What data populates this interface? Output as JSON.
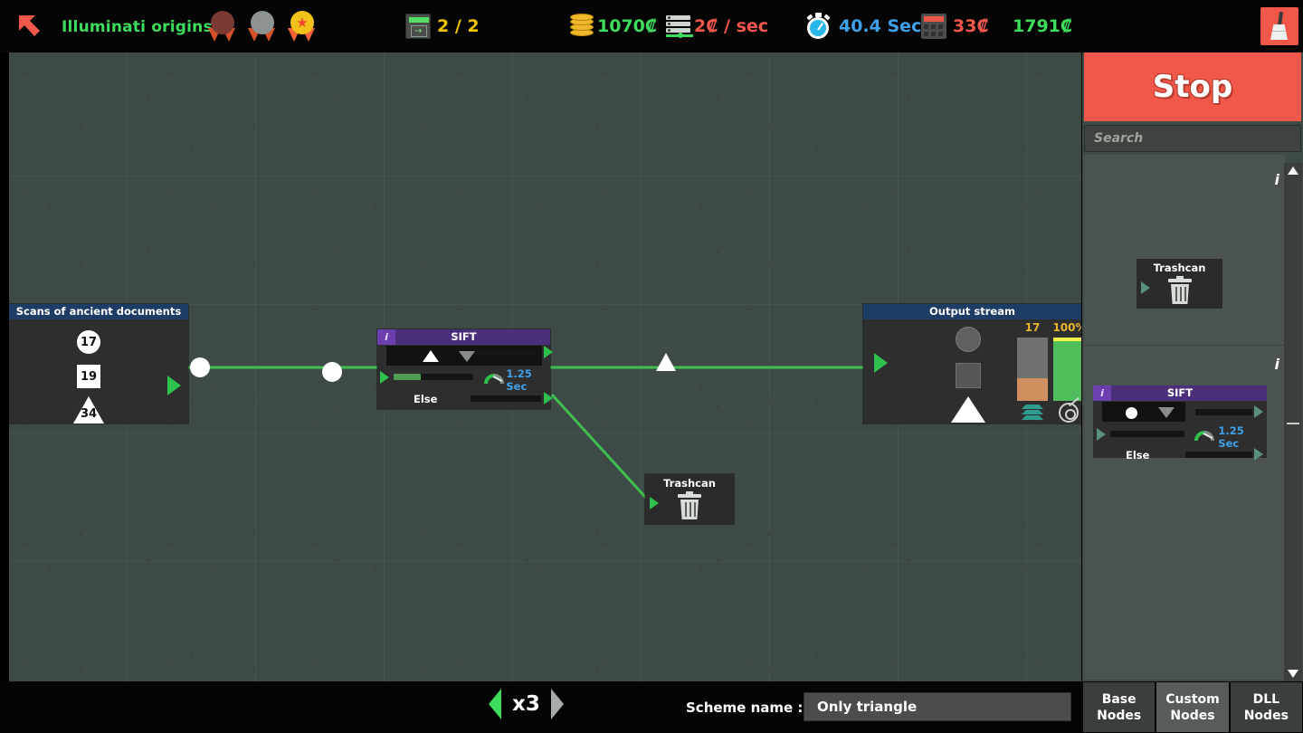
{
  "topbar": {
    "back_icon": "back-arrow-icon",
    "level_title": "Illuminati origins",
    "medals": [
      {
        "name": "bronze-medal",
        "color": "#7a3a33",
        "earned": false
      },
      {
        "name": "silver-medal",
        "color": "#8d9490",
        "earned": false
      },
      {
        "name": "gold-medal",
        "color": "#f2c21b",
        "earned": true,
        "star": "★"
      }
    ],
    "stats": [
      {
        "name": "exports",
        "icon": "export-icon",
        "value": "2 / 2",
        "color": "#f0c400"
      },
      {
        "name": "money",
        "icon": "coins-icon",
        "value": "1070₡",
        "color": "#3ddc5c"
      },
      {
        "name": "income-rate",
        "icon": "server-icon",
        "value": "2₡ / sec",
        "color": "#f2584a"
      },
      {
        "name": "elapsed-time",
        "icon": "stopwatch-icon",
        "value": "40.4 Sec",
        "color": "#3fa0e8"
      },
      {
        "name": "upkeep",
        "icon": "calculator-icon",
        "value": "33₡",
        "color": "#f2584a"
      },
      {
        "name": "total-earned",
        "icon": "",
        "value": "1791₡",
        "color": "#3ddc5c"
      }
    ],
    "clear_button": "broom-icon"
  },
  "canvas": {
    "nodes": {
      "source": {
        "title": "Scans of ancient documents",
        "items": [
          {
            "shape": "circle",
            "value": "17"
          },
          {
            "shape": "square",
            "value": "19"
          },
          {
            "shape": "triangle",
            "value": "34"
          }
        ]
      },
      "sift": {
        "title": "SIFT",
        "info_label": "i",
        "filter_shape": "triangle",
        "dropdown_icon": "chevron-down-icon",
        "speed_value": "1.25 Sec",
        "speed_icon": "gauge-icon",
        "else_label": "Else",
        "progress_percent": 22
      },
      "trashcan": {
        "title": "Trashcan",
        "icon": "trashcan-icon"
      },
      "output": {
        "title": "Output stream",
        "shapes": [
          "circle",
          "square",
          "triangle"
        ],
        "count_label": "17",
        "percent_label": "100%",
        "count_fill_percent": 36,
        "percent_fill_percent": 100,
        "layers_icon": "layers-icon",
        "target_icon": "target-icon"
      }
    }
  },
  "right_panel": {
    "stop_button": "Stop",
    "search_placeholder": "Search",
    "info_label": "i",
    "palette_items": [
      {
        "title": "Trashcan",
        "icon": "trashcan-icon"
      },
      {
        "title": "SIFT",
        "info_label": "i",
        "filter_shape": "circle",
        "dropdown_icon": "chevron-down-icon",
        "speed_value": "1.25 Sec",
        "else_label": "Else"
      }
    ],
    "scrollbar": {
      "up_icon": "caret-up-icon",
      "down_icon": "caret-down-icon"
    }
  },
  "bottom_bar": {
    "speed_prev_icon": "chevron-left-icon",
    "speed_value": "x3",
    "speed_next_icon": "chevron-right-icon",
    "scheme_label": "Scheme name :",
    "scheme_value": "Only triangle"
  },
  "tabs": [
    {
      "line1": "Base",
      "line2": "Nodes",
      "active": false
    },
    {
      "line1": "Custom",
      "line2": "Nodes",
      "active": true
    },
    {
      "line1": "DLL",
      "line2": "Nodes",
      "active": false
    }
  ]
}
